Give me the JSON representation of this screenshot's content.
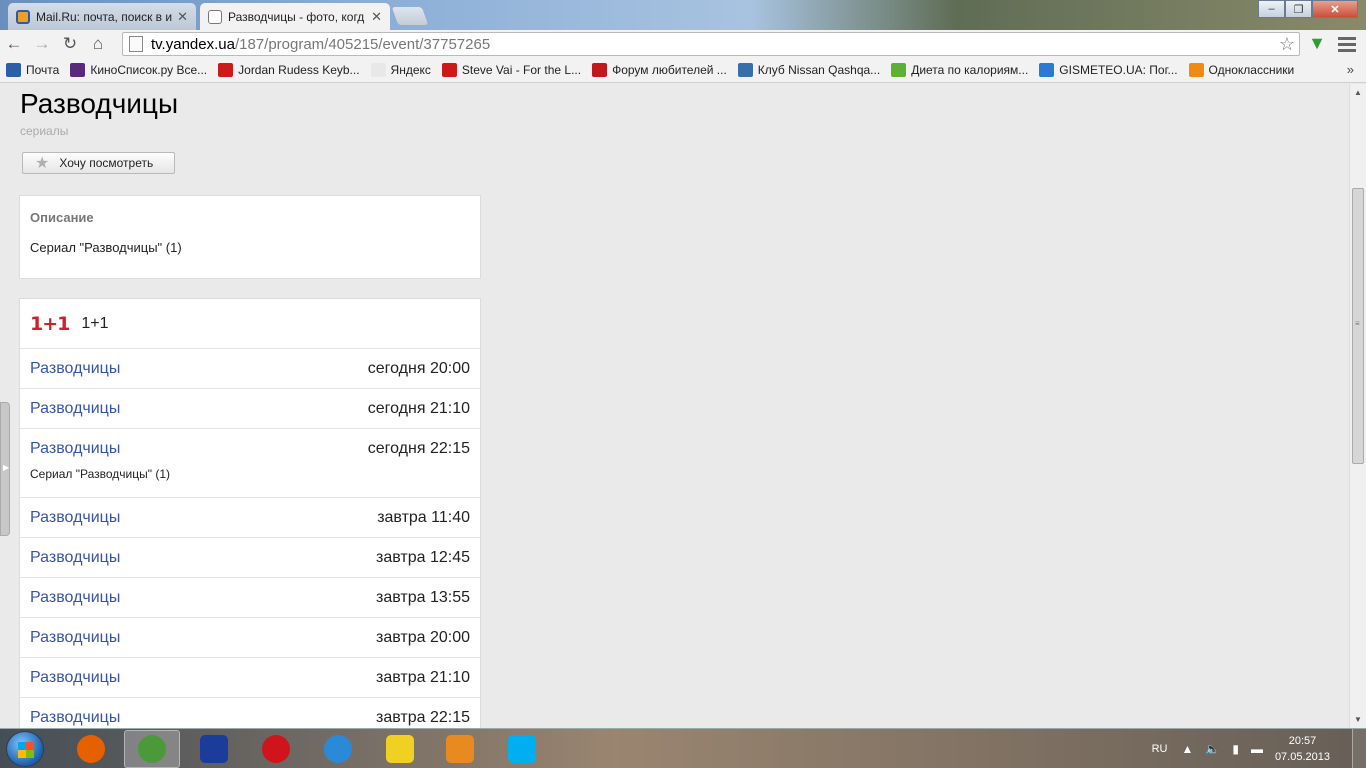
{
  "browser": {
    "tabs": [
      {
        "title": "Mail.Ru: почта, поиск в и",
        "close": "✕"
      },
      {
        "title": "Разводчицы - фото, когд",
        "close": "✕"
      }
    ],
    "url_host": "tv.yandex.ua",
    "url_path": "/187/program/405215/event/37757265",
    "window_buttons": {
      "minimize": "–",
      "maximize": "❐",
      "close": "✕"
    },
    "bookmarks": [
      {
        "label": "Почта",
        "color": "#2c5fa8"
      },
      {
        "label": "КиноСписок.ру Все...",
        "color": "#5a2a7a"
      },
      {
        "label": "Jordan Rudess Keyb...",
        "color": "#cc1a1a"
      },
      {
        "label": "Яндекс",
        "color": "#e8e8e8"
      },
      {
        "label": "Steve Vai - For the L...",
        "color": "#cc1a1a"
      },
      {
        "label": "Форум любителей ...",
        "color": "#c0181c"
      },
      {
        "label": "Клуб Nissan Qashqa...",
        "color": "#3a6ea8"
      },
      {
        "label": "Диета по калориям...",
        "color": "#5cb033"
      },
      {
        "label": "GISMETEO.UA: Пог...",
        "color": "#2a7ad0"
      },
      {
        "label": "Одноклассники",
        "color": "#f08a12"
      }
    ],
    "bookmarks_more": "»"
  },
  "page": {
    "title": "Разводчицы",
    "subtitle": "сериалы",
    "want_button": "Хочу посмотреть",
    "description": {
      "heading": "Описание",
      "text": "Сериал \"Разводчицы\" (1)"
    },
    "channel": {
      "logo": "1+1",
      "name": "1+1"
    },
    "schedule": [
      {
        "program": "Разводчицы",
        "time": "сегодня 20:00",
        "note": ""
      },
      {
        "program": "Разводчицы",
        "time": "сегодня 21:10",
        "note": ""
      },
      {
        "program": "Разводчицы",
        "time": "сегодня 22:15",
        "note": "Сериал \"Разводчицы\" (1)"
      },
      {
        "program": "Разводчицы",
        "time": "завтра 11:40",
        "note": ""
      },
      {
        "program": "Разводчицы",
        "time": "завтра 12:45",
        "note": ""
      },
      {
        "program": "Разводчицы",
        "time": "завтра 13:55",
        "note": ""
      },
      {
        "program": "Разводчицы",
        "time": "завтра 20:00",
        "note": ""
      },
      {
        "program": "Разводчицы",
        "time": "завтра 21:10",
        "note": ""
      },
      {
        "program": "Разводчицы",
        "time": "завтра 22:15",
        "note": ""
      }
    ]
  },
  "taskbar": {
    "apps": [
      {
        "name": "firefox-icon",
        "color": "#e66000"
      },
      {
        "name": "chrome-icon",
        "color": "#4a9a3a"
      },
      {
        "name": "save-disk-icon",
        "color": "#1c3c9c"
      },
      {
        "name": "opera-icon",
        "color": "#d0141c"
      },
      {
        "name": "internet-explorer-icon",
        "color": "#2a8ad8"
      },
      {
        "name": "batman-icon",
        "color": "#f0d020"
      },
      {
        "name": "media-player-icon",
        "color": "#e88a20"
      },
      {
        "name": "skype-icon",
        "color": "#00aff0"
      }
    ],
    "lang": "RU",
    "time": "20:57",
    "date": "07.05.2013"
  }
}
